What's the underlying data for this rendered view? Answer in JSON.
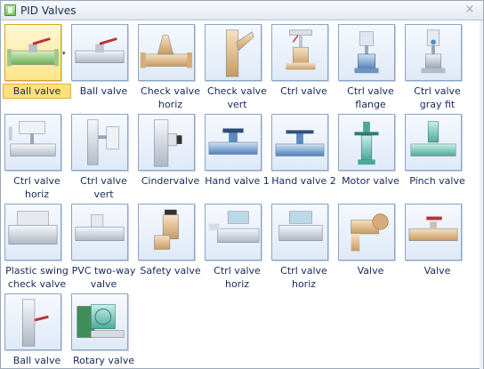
{
  "panel": {
    "title": "PID Valves",
    "close_glyph": "×"
  },
  "selected_index": 0,
  "items": [
    {
      "label": "Ball valve",
      "icon": "ball-valve-green-icon"
    },
    {
      "label": "Ball valve",
      "icon": "ball-valve-gray-icon"
    },
    {
      "label": "Check valve horiz",
      "icon": "check-valve-horiz-icon"
    },
    {
      "label": "Check valve vert",
      "icon": "check-valve-vert-icon"
    },
    {
      "label": "Ctrl valve",
      "icon": "ctrl-valve-icon"
    },
    {
      "label": "Ctrl valve flange",
      "icon": "ctrl-valve-flange-icon"
    },
    {
      "label": "Ctrl valve gray fit",
      "icon": "ctrl-valve-gray-fit-icon"
    },
    {
      "label": "Ctrl valve horiz",
      "icon": "ctrl-valve-horiz-icon"
    },
    {
      "label": "Ctrl valve vert",
      "icon": "ctrl-valve-vert-icon"
    },
    {
      "label": "Cindervalve",
      "icon": "cindervalve-icon"
    },
    {
      "label": "Hand valve 1",
      "icon": "hand-valve-1-icon"
    },
    {
      "label": "Hand valve 2",
      "icon": "hand-valve-2-icon"
    },
    {
      "label": "Motor valve",
      "icon": "motor-valve-icon"
    },
    {
      "label": "Pinch valve",
      "icon": "pinch-valve-icon"
    },
    {
      "label": "Plastic swing check valve",
      "icon": "plastic-swing-check-valve-icon"
    },
    {
      "label": "PVC two-way valve",
      "icon": "pvc-two-way-valve-icon"
    },
    {
      "label": "Safety valve",
      "icon": "safety-valve-icon"
    },
    {
      "label": "Ctrl valve horiz",
      "icon": "ctrl-valve-horiz-2-icon"
    },
    {
      "label": "Ctrl valve horiz",
      "icon": "ctrl-valve-horiz-3-icon"
    },
    {
      "label": "Valve",
      "icon": "valve-tan-icon"
    },
    {
      "label": "Valve",
      "icon": "valve-red-handle-icon"
    },
    {
      "label": "Ball valve",
      "icon": "ball-valve-vertical-icon"
    },
    {
      "label": "Rotary valve",
      "icon": "rotary-valve-icon"
    }
  ],
  "colors": {
    "selection": "#ffe17a",
    "thumb_border": "#8da4c4",
    "label_text": "#172a57"
  }
}
